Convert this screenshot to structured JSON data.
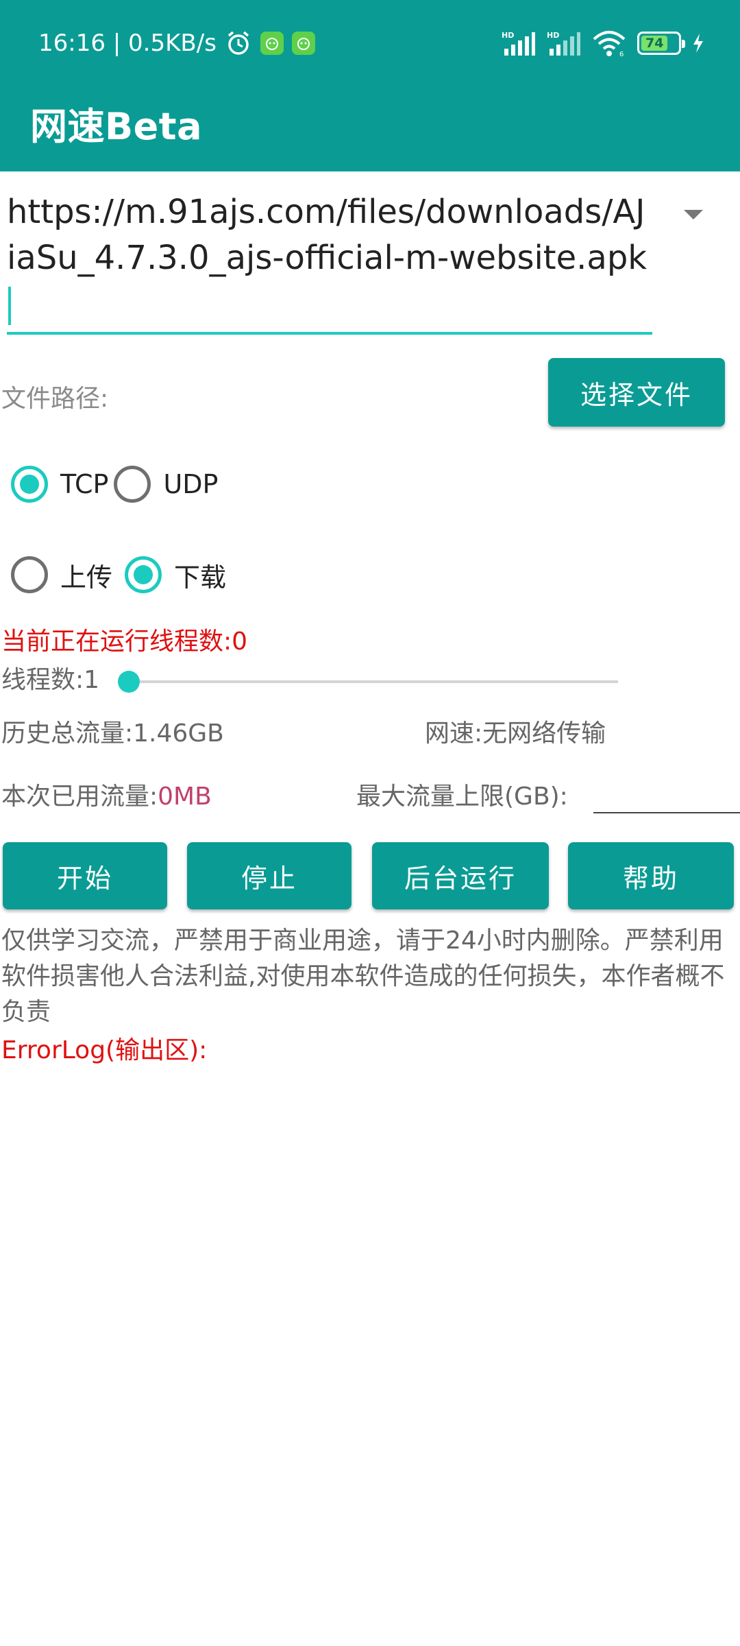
{
  "colors": {
    "primary": "#0a9c94",
    "accent": "#1bcbbf",
    "error_red": "#e01010",
    "value_pink": "#c2406a"
  },
  "status_bar": {
    "time_speed": "16:16 | 0.5KB/s",
    "icons": [
      "alarm-clock-icon",
      "app-notification-icon",
      "app-notification-icon",
      "hd-signal-icon",
      "hd-signal-icon",
      "wifi-icon",
      "battery-icon",
      "charging-icon"
    ],
    "battery_level": "74"
  },
  "app_bar": {
    "title": "网速Beta"
  },
  "url_input": {
    "value": "https://m.91ajs.com/files/downloads/AJiaSu_4.7.3.0_ajs-official-m-website.apk"
  },
  "file_path": {
    "label": "文件路径:",
    "choose_button": "选择文件"
  },
  "protocol": {
    "options": [
      {
        "label": "TCP",
        "checked": true
      },
      {
        "label": "UDP",
        "checked": false
      }
    ]
  },
  "direction": {
    "options": [
      {
        "label": "上传",
        "checked": false
      },
      {
        "label": "下载",
        "checked": true
      }
    ]
  },
  "stats": {
    "running_threads": "当前正在运行线程数:0",
    "thread_count": "线程数:1",
    "thread_slider_value": 1,
    "total_traffic": "历史总流量:1.46GB",
    "net_speed": "网速:无网络传输",
    "used_traffic_label": "本次已用流量:",
    "used_traffic_value": "0MB",
    "max_traffic_label": "最大流量上限(GB):",
    "max_traffic_value": ""
  },
  "actions": {
    "start": "开始",
    "stop": "停止",
    "background": "后台运行",
    "help": "帮助"
  },
  "disclaimer": "仅供学习交流，严禁用于商业用途，请于24小时内删除。严禁利用软件损害他人合法利益,对使用本软件造成的任何损失，本作者概不负责",
  "error_log_label": "ErrorLog(输出区):"
}
